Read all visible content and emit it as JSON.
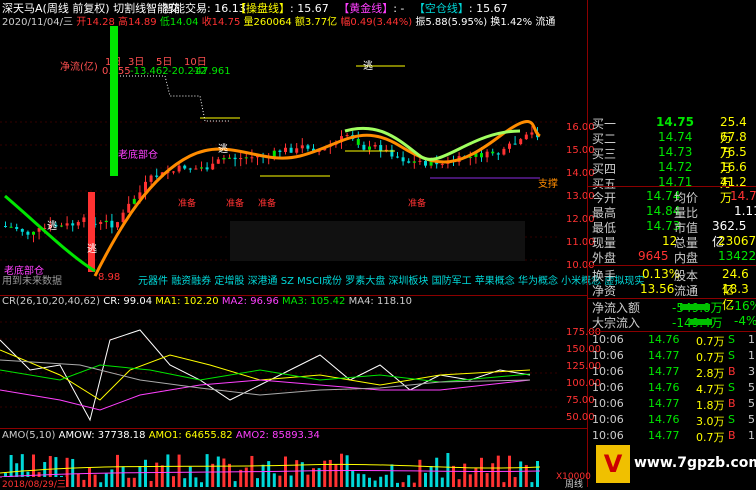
{
  "header": {
    "stock": "深天马A(周线 前复权)",
    "indicator": "切割线智能交",
    "smart_trade": "智能交易: 16.13",
    "btn_operate": "【操盘线】",
    "btn_operate_val": ": 15.67",
    "btn_gold": "【黄金线】",
    "btn_gold_val": ": -",
    "btn_short": "【空仓线】",
    "btn_short_val": ": 15.67",
    "date": "2020/11/04/三",
    "open": "开14.28",
    "high": "高14.89",
    "low": "低14.04",
    "close": "收14.75",
    "volume": "量260064",
    "amount": "额3.77亿",
    "change": "幅0.49(3.44%)",
    "amplitude": "振5.88(5.95%)",
    "turnover": "换1.42%",
    "float": "流通"
  },
  "netflow": {
    "label": "净流(亿)",
    "periods": [
      "1日",
      "3日",
      "5日",
      "10日"
    ],
    "values": [
      "0.655",
      "-13.462",
      "-20.212",
      "-47.961"
    ]
  },
  "chart_labels": {
    "escape1": "逃",
    "escape2": "逃",
    "escape3": "逃",
    "escape4": "逃",
    "bottom1": "老底部仓",
    "bottom2": "老底部仓",
    "prepare": "准备",
    "prepare2": "准备",
    "prepare3": "准备",
    "prepare4": "准备",
    "support": "支撑",
    "low_price": "8.98",
    "hint": "用到未来数据",
    "buy_tag": "B",
    "sell_tag": "S"
  },
  "concepts": [
    "元器件",
    "融资融券",
    "定增股",
    "深港通",
    "SZ MSCI成份",
    "罗素大盘",
    "深圳板块",
    "国防军工",
    "苹果概念",
    "华为概念",
    "小米概念",
    "虚拟现实"
  ],
  "price_axis": [
    "16.00",
    "15.00",
    "14.00",
    "13.00",
    "12.00",
    "11.00",
    "10.00"
  ],
  "cr": {
    "title": "CR(26,10,20,40,62)",
    "cr": "CR: 99.04",
    "ma1": "MA1: 102.20",
    "ma2": "MA2: 96.96",
    "ma3": "MA3: 105.42",
    "ma4": "MA4: 118.10",
    "axis": [
      "175.00",
      "150.00",
      "125.00",
      "100.00",
      "75.00",
      "50.00"
    ]
  },
  "amo": {
    "title": "AMO(5,10)",
    "amow": "AMOW: 37738.18",
    "amo1": "AMO1: 64655.82",
    "amo2": "AMO2: 85893.34",
    "unit": "X10000",
    "date": "2018/08/29/三",
    "flag": "周线"
  },
  "order_book": [
    {
      "label": "买一",
      "price": "14.75",
      "vol": "25.4万"
    },
    {
      "label": "买二",
      "price": "14.74",
      "vol": "67.8万"
    },
    {
      "label": "买三",
      "price": "14.73",
      "vol": "76.5万"
    },
    {
      "label": "买四",
      "price": "14.72",
      "vol": "16.6万"
    },
    {
      "label": "买五",
      "price": "14.71",
      "vol": "41.2万"
    }
  ],
  "stats": [
    {
      "l1": "今开",
      "v1": "14.74",
      "l2": "均价",
      "v2": "14.79"
    },
    {
      "l1": "最高",
      "v1": "14.84",
      "l2": "量比",
      "v2": "1.11"
    },
    {
      "l1": "最低",
      "v1": "14.73",
      "l2": "市值",
      "v2": "362.5亿"
    },
    {
      "l1": "现量",
      "v1": "12",
      "l2": "总量",
      "v2": "23067"
    },
    {
      "l1": "外盘",
      "v1": "9645",
      "l2": "内盘",
      "v2": "13422"
    }
  ],
  "stats2": [
    {
      "l1": "换手",
      "v1": "0.13%",
      "l2": "股本",
      "v2": "24.6亿"
    },
    {
      "l1": "净资",
      "v1": "13.56",
      "l2": "流通",
      "v2": "18.3亿"
    }
  ],
  "flows": [
    {
      "label": "净流入额",
      "value": "-549.0万",
      "pct": "-16%"
    },
    {
      "label": "大宗流入",
      "value": "-149.4万",
      "pct": "-4%"
    }
  ],
  "ticks": [
    {
      "time": "10:06",
      "price": "14.76",
      "vol": "0.7万",
      "side": "S",
      "n": "1"
    },
    {
      "time": "10:06",
      "price": "14.77",
      "vol": "0.7万",
      "side": "S",
      "n": "1"
    },
    {
      "time": "10:06",
      "price": "14.77",
      "vol": "2.8万",
      "side": "B",
      "n": "3"
    },
    {
      "time": "10:06",
      "price": "14.76",
      "vol": "4.7万",
      "side": "S",
      "n": "5"
    },
    {
      "time": "10:06",
      "price": "14.77",
      "vol": "1.8万",
      "side": "B",
      "n": "5"
    },
    {
      "time": "10:06",
      "price": "14.76",
      "vol": "3.0万",
      "side": "S",
      "n": "5"
    },
    {
      "time": "10:06",
      "price": "14.77",
      "vol": "0.7万",
      "side": "B",
      "n": "1"
    }
  ],
  "watermark": "www.7gpzb.com",
  "colors": {
    "up": "#ff3232",
    "down": "#00d8d8",
    "green": "#00e600",
    "yellow": "#ffff00",
    "magenta": "#ff40ff",
    "orange": "#ff8c00",
    "white": "#ffffff"
  }
}
